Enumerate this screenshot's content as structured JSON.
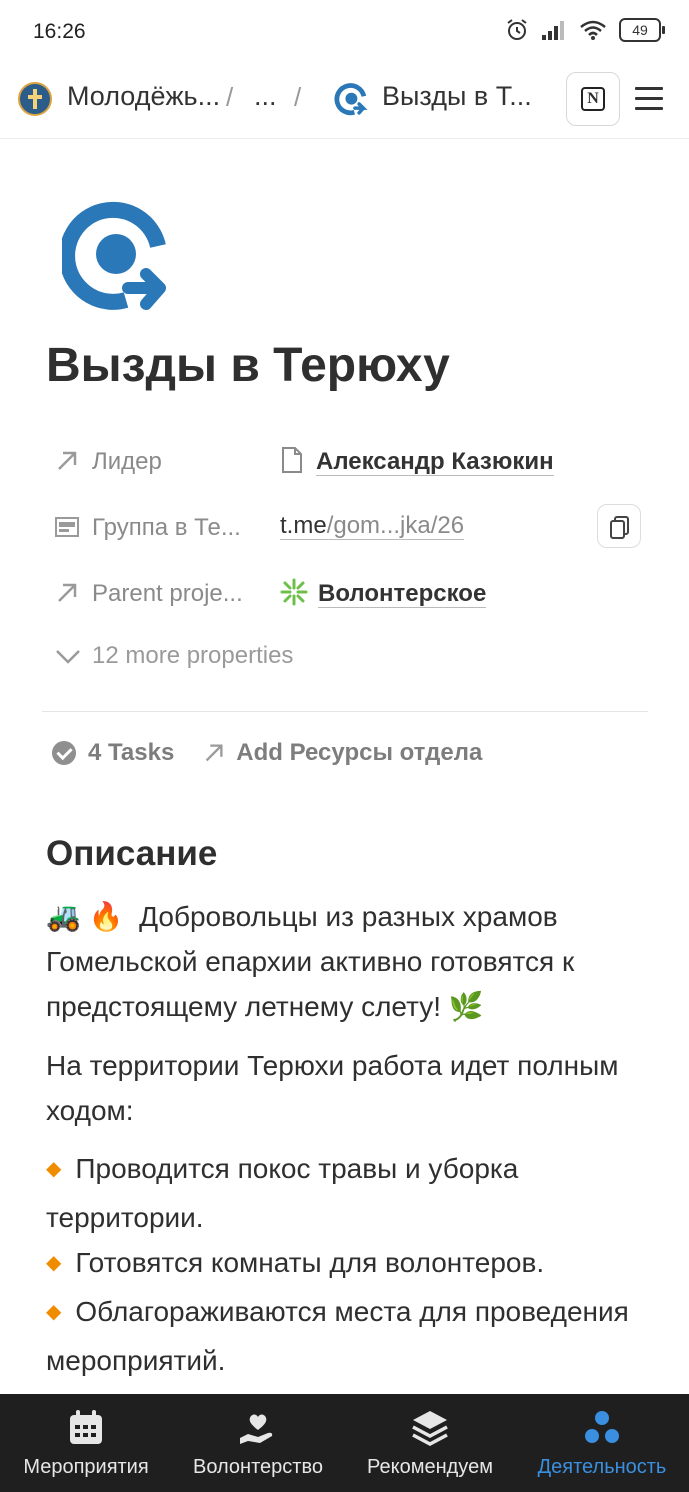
{
  "status_bar": {
    "time": "16:26",
    "battery": "49"
  },
  "nav": {
    "crumb_root": "Молодёжь...",
    "crumb_mid": "...",
    "crumb_current": "Вызды в Т...",
    "separator": "/"
  },
  "page": {
    "title": "Вызды в Терюху",
    "properties": [
      {
        "label": "Лидер",
        "value": "Александр Казюкин",
        "icon": "arrow-relation-icon"
      },
      {
        "label": "Группа в Те...",
        "value_main": "t.me",
        "value_dim": "/gom...jka/26",
        "icon": "url-field-icon"
      },
      {
        "label": "Parent proje...",
        "value": "Волонтерское",
        "icon": "arrow-relation-icon"
      }
    ],
    "more_properties": "12 more properties",
    "tasks_label": "4 Tasks",
    "add_resource_label": "Add Ресурсы отдела"
  },
  "content": {
    "heading": "Описание",
    "para1": "Добровольцы из разных храмов Гомельской епархии активно готовятся к предстоящему летнему слету!",
    "para2": "На территории Терюхи работа идет полным ходом:",
    "bullets": [
      "Проводится покос травы и уборка территории.",
      "Готовятся комнаты для волонтеров.",
      "Облагораживаются места для проведения мероприятий."
    ],
    "emoji1": "🚜",
    "emoji2": "🔥",
    "emoji3": "🌿"
  },
  "bottom_nav": [
    {
      "label": "Мероприятия",
      "icon": "calendar-icon"
    },
    {
      "label": "Волонтерство",
      "icon": "heart-hand-icon"
    },
    {
      "label": "Рекомендуем",
      "icon": "layers-icon"
    },
    {
      "label": "Деятельность",
      "icon": "dots-icon",
      "active": true
    }
  ],
  "colors": {
    "accent": "#3a8fe0",
    "icon_blue": "#2a78b8",
    "bullet": "#f08c00"
  }
}
